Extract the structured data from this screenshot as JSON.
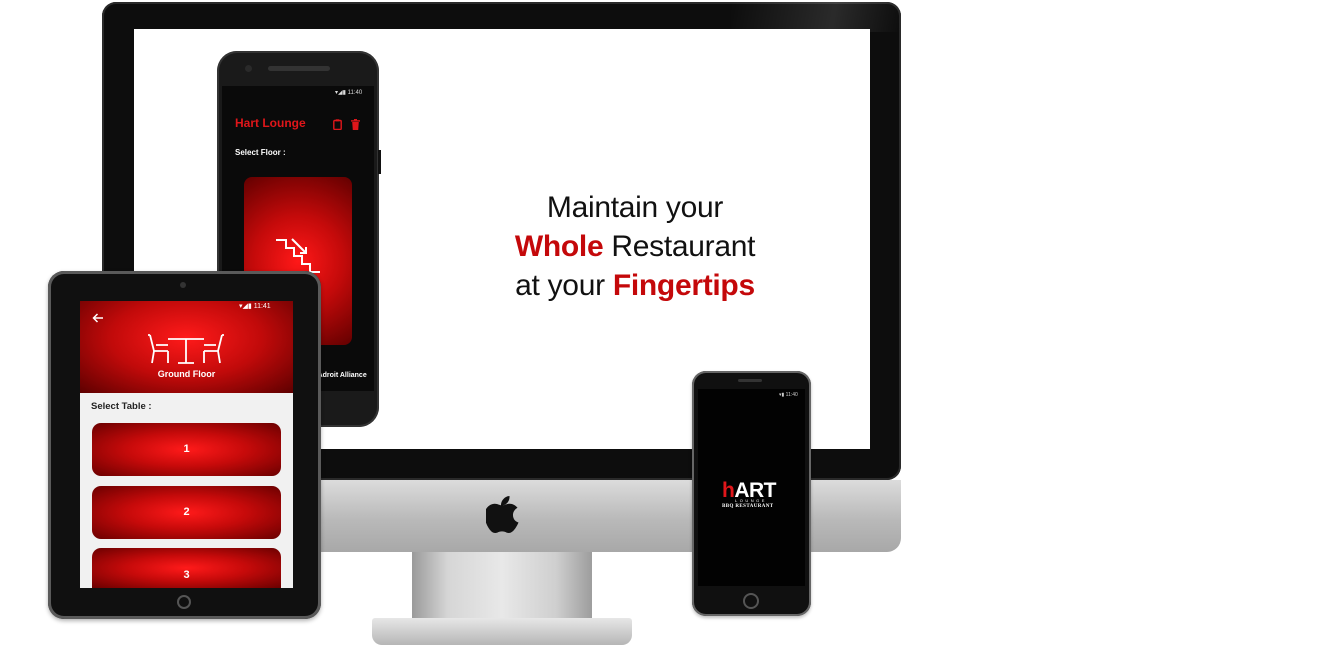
{
  "headline": {
    "line1": "Maintain your",
    "line2_accent": "Whole",
    "line2_rest": "Restaurant",
    "line3_pre": "at your",
    "line3_accent": "Fingertips"
  },
  "colors": {
    "accent": "#c4080a",
    "screen_bg": "#ffffff",
    "device_dark": "#101010"
  },
  "desktop_phone": {
    "status_time": "11:40",
    "app_title": "Hart Lounge",
    "icons": [
      "clipboard-icon",
      "trash-icon"
    ],
    "select_label": "Select Floor :",
    "floor_icon": "stairs-down-icon",
    "card_caption": "r",
    "footer_text": "y Adroit Alliance"
  },
  "tablet": {
    "status_time": "11:41",
    "back_icon": "arrow-left-icon",
    "floor_icon": "table-chairs-icon",
    "floor_name": "Ground Floor",
    "select_label": "Select Table :",
    "tables": [
      "1",
      "2",
      "3"
    ]
  },
  "iphone": {
    "status_time": "11:40",
    "logo_mark": "h",
    "logo_text": "ART",
    "logo_sub": "LOUNGE",
    "logo_tagline": "BBQ RESTAURANT"
  }
}
